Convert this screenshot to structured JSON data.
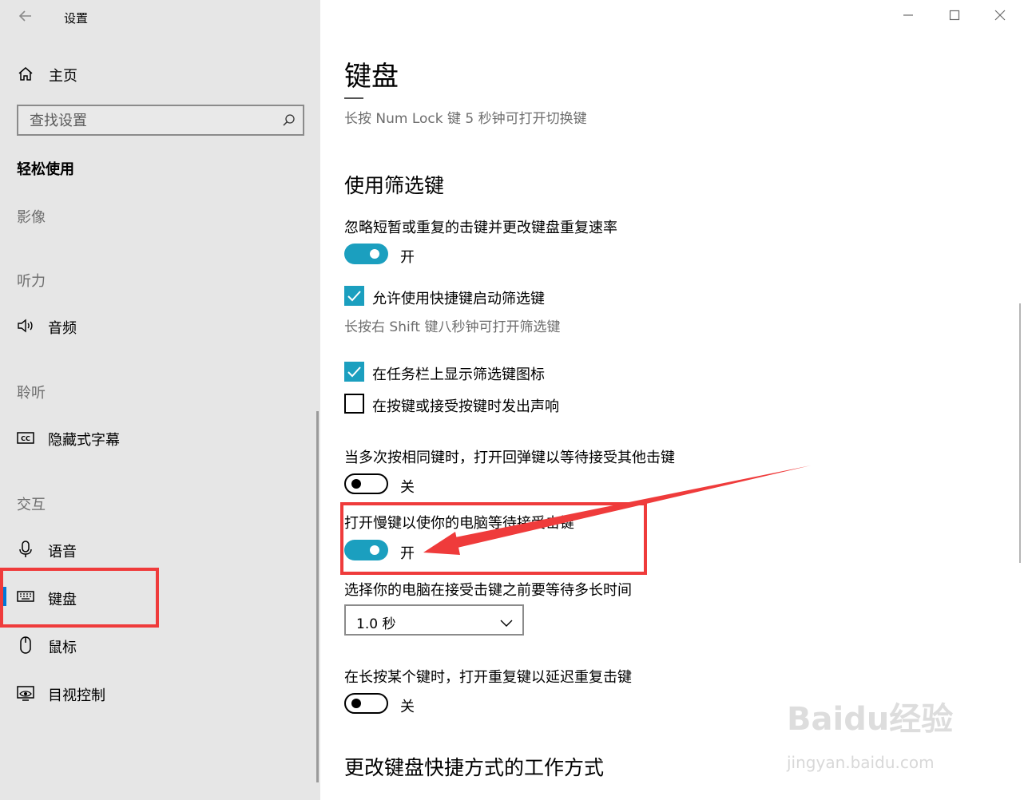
{
  "window": {
    "title": "设置",
    "controls": [
      "minimize",
      "maximize",
      "close"
    ]
  },
  "sidebar": {
    "home_label": "主页",
    "search_placeholder": "查找设置",
    "section_title": "轻松使用",
    "groups": {
      "vision": "影像",
      "hearing": "听力",
      "listening": "聆听",
      "interaction": "交互"
    },
    "items": {
      "audio": "音频",
      "captions": "隐藏式字幕",
      "speech": "语音",
      "keyboard": "键盘",
      "mouse": "鼠标",
      "eye_control": "目视控制"
    },
    "selected_item": "键盘"
  },
  "main": {
    "page_title": "键盘",
    "numlock_hint": "长按 Num Lock 键 5 秒钟可打开切换键",
    "filter_section_title": "使用筛选键",
    "filter_toggle_desc": "忽略短暂或重复的击键并更改键盘重复速率",
    "filter_toggle_state": "开",
    "filter_shortcut_label": "允许使用快捷键启动筛选键",
    "filter_shortcut_hint": "长按右 Shift 键八秒钟可打开筛选键",
    "taskbar_icon_label": "在任务栏上显示筛选键图标",
    "beep_label": "在按键或接受按键时发出声响",
    "bounce_desc": "当多次按相同键时，打开回弹键以等待接受其他击键",
    "bounce_state": "关",
    "slow_desc": "打开慢键以使你的电脑等待接受击键",
    "slow_state": "开",
    "wait_desc": "选择你的电脑在接受击键之前要等待多长时间",
    "wait_value": "1.0 秒",
    "repeat_desc": "在长按某个键时，打开重复键以延迟重复击键",
    "repeat_state": "关",
    "shortcut_section_title": "更改键盘快捷方式的工作方式"
  },
  "checkboxes": {
    "filter_shortcut": true,
    "taskbar_icon": true,
    "beep": false
  },
  "toggles": {
    "filter_keys": "on",
    "bounce_keys": "off",
    "slow_keys": "on",
    "repeat_keys": "off"
  },
  "watermark": {
    "logo": "Baidu经验",
    "url": "jingyan.baidu.com"
  },
  "colors": {
    "accent": "#1b9fbf",
    "annotation": "#ef3b3b",
    "sidebar_bg": "#e6e6e6",
    "selection": "#0078d7"
  }
}
